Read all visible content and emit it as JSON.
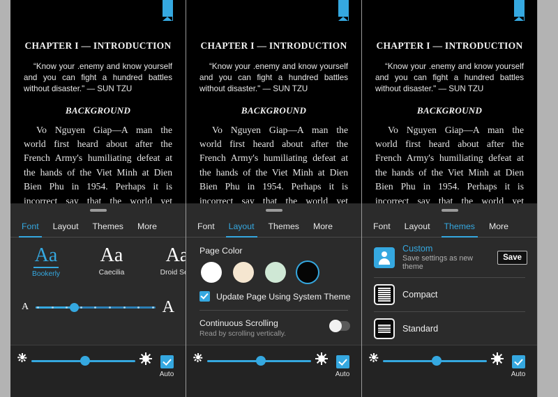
{
  "reader": {
    "bookmark_icon": "bookmark-ribbon-icon",
    "chapter_title": "CHAPTER I — INTRODUCTION",
    "quote": "“Know your .enemy and know yourself and you can fight a hundred battles without disaster.\" — SUN TZU",
    "section_heading": "BACKGROUND",
    "body": "Vo Nguyen Giap—A man the world first heard about after the French Army's humiliating defeat at the hands of the Viet Minh at Dien Bien Phu in 1954. Perhaps it is incorrect say that the world yet recognizes the name. Outside of a relatively small circle, few people know who Giap is. Those who do, however, know his impor-"
  },
  "tabs": [
    {
      "label": "Font"
    },
    {
      "label": "Layout"
    },
    {
      "label": "Themes"
    },
    {
      "label": "More"
    }
  ],
  "panels": {
    "font": {
      "active_tab": "Font",
      "fonts": [
        {
          "sample": "Aa",
          "label": "Bookerly",
          "selected": true
        },
        {
          "sample": "Aa",
          "label": "Caecilia",
          "selected": false
        },
        {
          "sample": "Aa",
          "label": "Droid Serif",
          "selected": false
        }
      ],
      "size_slider": {
        "small_label": "A",
        "large_label": "A",
        "value_pct": 32,
        "ticks": 9
      }
    },
    "layout": {
      "active_tab": "Layout",
      "page_color_label": "Page Color",
      "swatches": [
        {
          "name": "white",
          "color": "#ffffff",
          "selected": false
        },
        {
          "name": "sepia",
          "color": "#f5e6d0",
          "selected": false
        },
        {
          "name": "green",
          "color": "#cfe8d5",
          "selected": false
        },
        {
          "name": "black",
          "color": "#050505",
          "selected": true
        }
      ],
      "system_theme_checkbox": {
        "label": "Update Page Using System Theme",
        "checked": true
      },
      "continuous_scrolling": {
        "title": "Continuous Scrolling",
        "subtitle": "Read by scrolling vertically.",
        "enabled": false
      }
    },
    "themes": {
      "active_tab": "Themes",
      "items": [
        {
          "icon": "person-avatar-icon",
          "name": "Custom",
          "sub": "Save settings as new theme",
          "accent": true,
          "action_label": "Save"
        },
        {
          "icon": "compact-lines-icon",
          "name": "Compact",
          "sub": "",
          "accent": false,
          "action_label": ""
        },
        {
          "icon": "standard-lines-icon",
          "name": "Standard",
          "sub": "",
          "accent": false,
          "action_label": ""
        }
      ]
    }
  },
  "brightness": {
    "low_icon": "sun-low-icon",
    "high_icon": "sun-high-icon",
    "value_pct": 52,
    "auto": {
      "label": "Auto",
      "checked": true
    }
  },
  "colors": {
    "accent": "#35a8e0",
    "panel_bg": "#2b2b2b",
    "bright_bg": "#232323",
    "page_bg": "#000000",
    "outer_bg": "#b3b3b3"
  }
}
